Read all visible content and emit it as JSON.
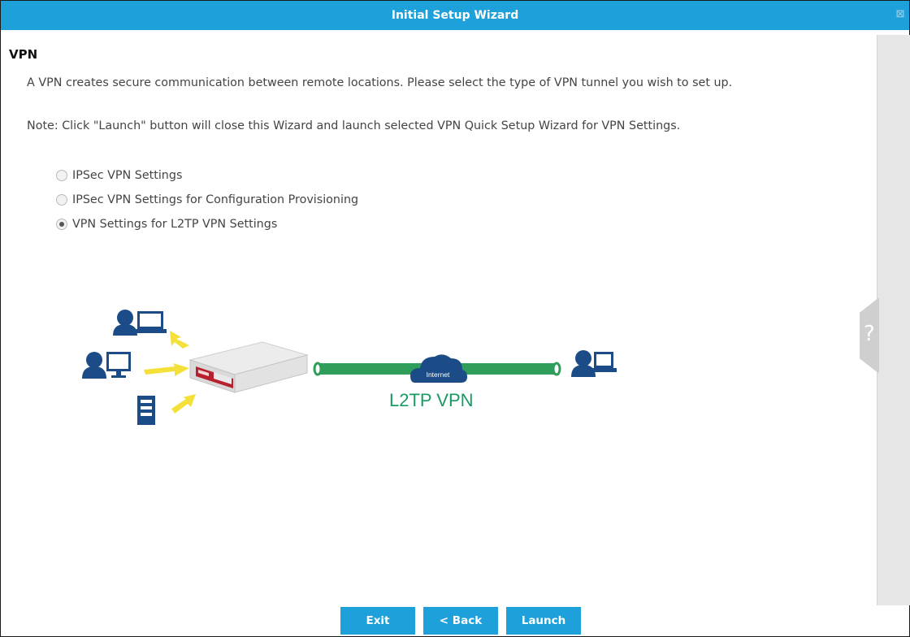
{
  "window": {
    "title": "Initial Setup Wizard",
    "close_glyph": "⊠"
  },
  "section": {
    "heading": "VPN",
    "description": "A VPN creates secure communication between remote locations. Please select the type of VPN tunnel you wish to set up.",
    "note": "Note: Click \"Launch\" button will close this Wizard and launch selected VPN Quick Setup Wizard for VPN Settings."
  },
  "vpn_options": [
    {
      "label": "IPSec VPN Settings",
      "checked": false
    },
    {
      "label": "IPSec VPN Settings for Configuration Provisioning",
      "checked": false
    },
    {
      "label": "VPN Settings for L2TP VPN Settings",
      "checked": true
    }
  ],
  "diagram": {
    "cloud_label": "Internet",
    "tunnel_label": "L2TP VPN",
    "colors": {
      "tunnel": "#2e9e5a",
      "arrow": "#f5e03a",
      "device": "#1b4c87",
      "router_accent": "#b8202e"
    },
    "icons": [
      "user-laptop-icon",
      "user-desktop-icon",
      "server-icon",
      "router-icon",
      "internet-cloud-icon",
      "remote-user-laptop-icon"
    ]
  },
  "help_tab": {
    "glyph": "?"
  },
  "footer": {
    "exit_label": "Exit",
    "back_label": "< Back",
    "launch_label": "Launch"
  },
  "colors": {
    "accent": "#1ea0da"
  }
}
